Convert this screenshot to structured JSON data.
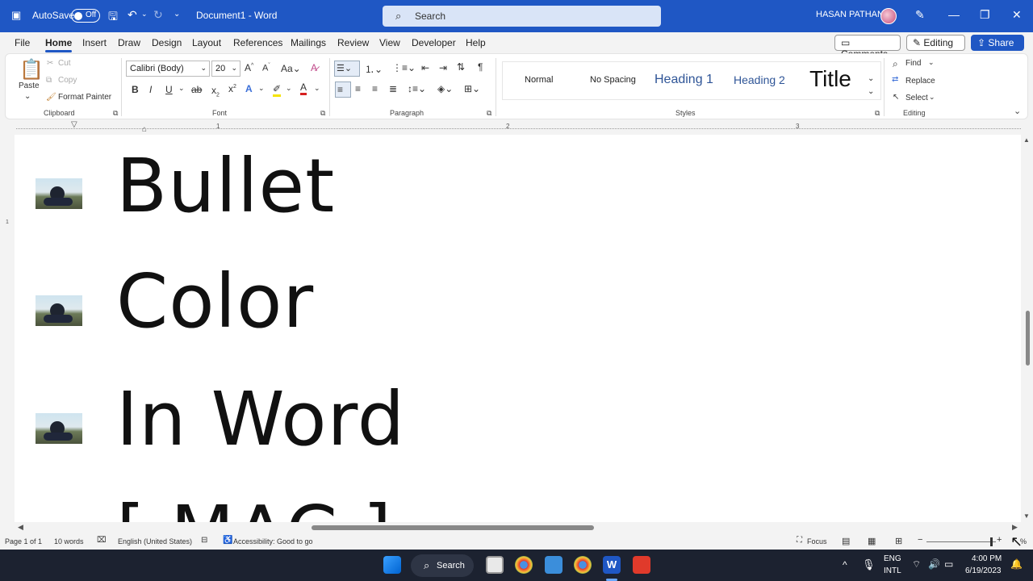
{
  "titlebar": {
    "autosave_label": "AutoSave",
    "autosave_state": "Off",
    "doc_title": "Document1  -  Word",
    "search_placeholder": "Search",
    "user_name": "HASAN PATHAN"
  },
  "menu": {
    "tabs": [
      "File",
      "Home",
      "Insert",
      "Draw",
      "Design",
      "Layout",
      "References",
      "Mailings",
      "Review",
      "View",
      "Developer",
      "Help"
    ],
    "active_tab": "Home",
    "comments_label": "Comments",
    "editing_label": "Editing",
    "share_label": "Share"
  },
  "ribbon": {
    "clipboard": {
      "paste": "Paste",
      "cut": "Cut",
      "copy": "Copy",
      "format_painter": "Format Painter",
      "group": "Clipboard"
    },
    "font": {
      "family": "Calibri (Body)",
      "size": "20",
      "group": "Font"
    },
    "paragraph": {
      "group": "Paragraph"
    },
    "styles": {
      "items": [
        "Normal",
        "No Spacing",
        "Heading 1",
        "Heading 2",
        "Title"
      ],
      "group": "Styles"
    },
    "editing": {
      "find": "Find",
      "replace": "Replace",
      "select": "Select",
      "group": "Editing"
    }
  },
  "ruler": {
    "numbers": [
      "1",
      "2",
      "3"
    ]
  },
  "document": {
    "lines": [
      "Bullet",
      "Color",
      "In Word",
      "[ MAC ]"
    ]
  },
  "status": {
    "page": "Page 1 of 1",
    "words": "10 words",
    "language": "English (United States)",
    "accessibility": "Accessibility: Good to go",
    "focus": "Focus",
    "zoom": "%"
  },
  "taskbar": {
    "search": "Search",
    "lang1": "ENG",
    "lang2": "INTL",
    "time": "4:00 PM",
    "date": "6/19/2023"
  },
  "colors": {
    "accent": "#1f57c4",
    "taskbar": "#1c2230"
  }
}
